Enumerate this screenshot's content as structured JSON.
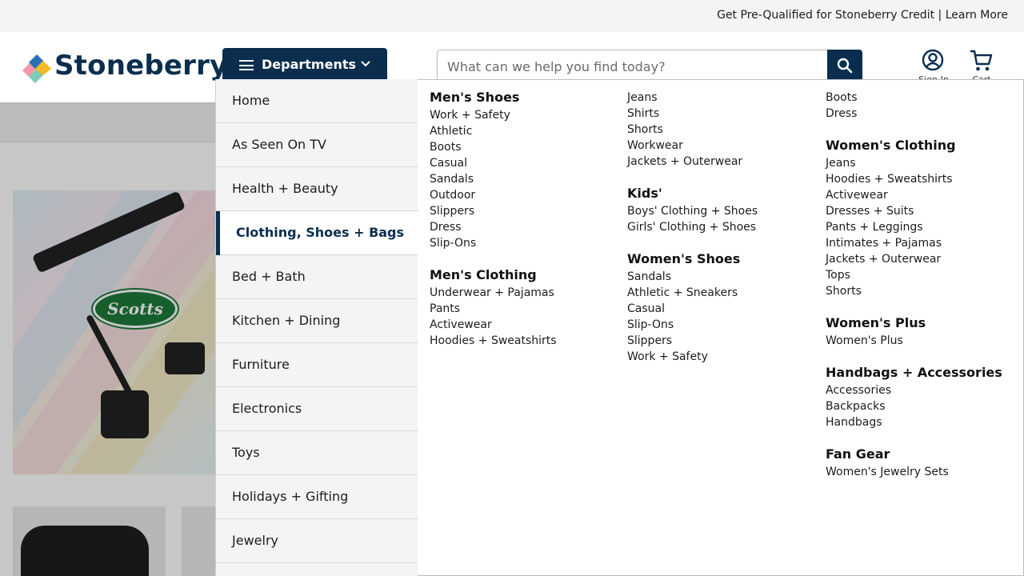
{
  "topbar": {
    "promo_text": "Get Pre-Qualified for Stoneberry Credit",
    "separator": " | ",
    "learn_more": "Learn More"
  },
  "header": {
    "logo_text": "Stoneberry",
    "departments_label": "Departments",
    "search_placeholder": "What can we help you find today?",
    "account_label": "Sign In",
    "cart_label": "Cart"
  },
  "colors": {
    "brand_navy": "#0b2e4f",
    "logo_blue": "#2a6fb6",
    "logo_yellow": "#f5b921",
    "logo_pink": "#f29aa8",
    "logo_teal": "#7fcbb5"
  },
  "hero": {
    "brand_badge": "Scotts"
  },
  "departments": [
    {
      "label": "Home",
      "active": false
    },
    {
      "label": "As Seen On TV",
      "active": false
    },
    {
      "label": "Health + Beauty",
      "active": false
    },
    {
      "label": "Clothing, Shoes + Bags",
      "active": true
    },
    {
      "label": "Bed + Bath",
      "active": false
    },
    {
      "label": "Kitchen + Dining",
      "active": false
    },
    {
      "label": "Furniture",
      "active": false
    },
    {
      "label": "Electronics",
      "active": false
    },
    {
      "label": "Toys",
      "active": false
    },
    {
      "label": "Holidays + Gifting",
      "active": false
    },
    {
      "label": "Jewelry",
      "active": false
    }
  ],
  "flyout": {
    "col1": {
      "mens_shoes": {
        "title": "Men's Shoes",
        "links": [
          "Work + Safety",
          "Athletic",
          "Boots",
          "Casual",
          "Sandals",
          "Outdoor",
          "Slippers",
          "Dress",
          "Slip-Ons"
        ]
      },
      "mens_clothing": {
        "title": "Men's Clothing",
        "links": [
          "Underwear + Pajamas",
          "Pants",
          "Activewear",
          "Hoodies + Sweatshirts"
        ]
      }
    },
    "col2": {
      "mens_clothing_cont": {
        "links": [
          "Jeans",
          "Shirts",
          "Shorts",
          "Workwear",
          "Jackets + Outerwear"
        ]
      },
      "kids": {
        "title": "Kids'",
        "links": [
          "Boys' Clothing + Shoes",
          "Girls' Clothing + Shoes"
        ]
      },
      "womens_shoes": {
        "title": "Women's Shoes",
        "links": [
          "Sandals",
          "Athletic + Sneakers",
          "Casual",
          "Slip-Ons",
          "Slippers",
          "Work + Safety"
        ]
      }
    },
    "col3": {
      "womens_shoes_cont": {
        "links": [
          "Boots",
          "Dress"
        ]
      },
      "womens_clothing": {
        "title": "Women's Clothing",
        "links": [
          "Jeans",
          "Hoodies + Sweatshirts",
          "Activewear",
          "Dresses + Suits",
          "Pants + Leggings",
          "Intimates + Pajamas",
          "Jackets + Outerwear",
          "Tops",
          "Shorts"
        ]
      },
      "womens_plus": {
        "title": "Women's Plus",
        "links": [
          "Women's Plus"
        ]
      },
      "handbags": {
        "title": "Handbags + Accessories",
        "links": [
          "Accessories",
          "Backpacks",
          "Handbags"
        ]
      },
      "fan_gear": {
        "title": "Fan Gear",
        "links": [
          "Women's Jewelry Sets"
        ]
      }
    }
  }
}
